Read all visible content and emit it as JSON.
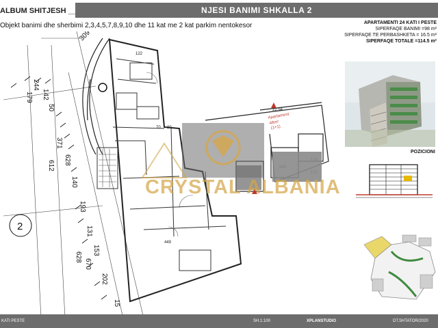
{
  "header": {
    "album": "ALBUM SHITJESH ____",
    "title": "NJESI BANIMI  SHKALLA 2",
    "subtitle": "Objekt banimi dhe sherbimi 2,3,4,5,7,8,9,10 dhe 11 kat me 2 kat parkim nentokesor"
  },
  "info": {
    "apartment": "APARTAMENTI 24 KATI I PESTE",
    "area_living": "SIPERFAQE BANIMI =98 m²",
    "area_shared": "SIPERFAQE TE PERBASHKETA = 16.5 m²",
    "area_total": "SIPERFAQE TOTALE =114.5 m²"
  },
  "plan": {
    "grid_marker": "2",
    "dims_left": [
      "244",
      "142",
      "179",
      "50",
      "371",
      "628",
      "612",
      "140",
      "193",
      "131",
      "153",
      "628",
      "670",
      "202",
      "15"
    ],
    "dims_top": [
      "309",
      "122"
    ],
    "room_dims": [
      "70",
      "80",
      "449",
      "140",
      "170",
      "170"
    ],
    "apartment_label": "Apartament",
    "apartment_area": "48m²",
    "apartment_type": "(1+1)",
    "level_label": "22.94"
  },
  "side": {
    "positioning": "POZICIONI"
  },
  "watermark": {
    "text": "CRYSTAL ALBANIA"
  },
  "footer": {
    "left": "KATI PESTE",
    "scale": "SH.1:100",
    "studio": "XPLANSTUDIO",
    "date": "DT.SHTATOR/2020"
  },
  "colors": {
    "title_bar": "#6d6d6d",
    "watermark": "#d4a64a",
    "accent_red": "#c0392b",
    "highlight_yellow": "#e9d76a",
    "green": "#3f8a3f"
  }
}
